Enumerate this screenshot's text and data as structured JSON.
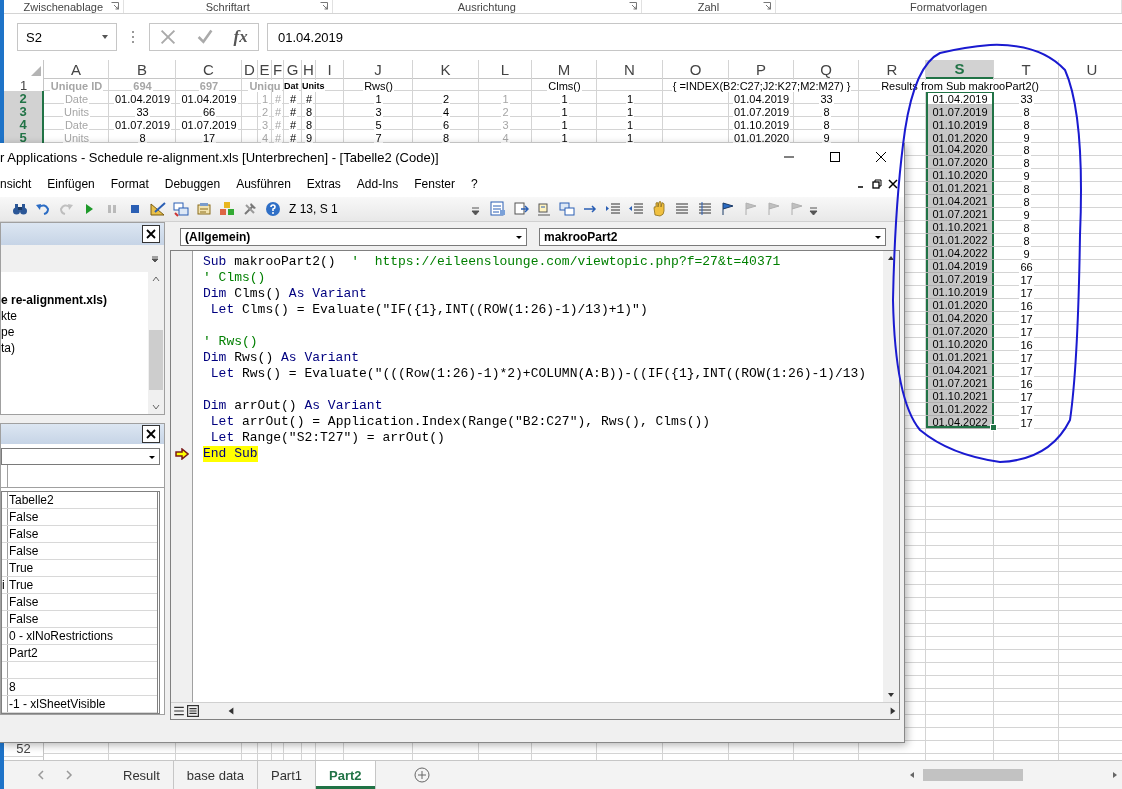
{
  "ribbon_groups": [
    {
      "label": "Zwischenablage"
    },
    {
      "label": "Schriftart"
    },
    {
      "label": "Ausrichtung"
    },
    {
      "label": "Zahl"
    },
    {
      "label": "Formatvorlagen"
    }
  ],
  "formula_bar": {
    "name_box": "S2",
    "function_label": "fx",
    "formula": "01.04.2019"
  },
  "grid": {
    "columns": [
      {
        "letter": "A",
        "selected": false
      },
      {
        "letter": "B",
        "selected": false
      },
      {
        "letter": "C",
        "selected": false
      },
      {
        "letter": "D",
        "selected": false
      },
      {
        "letter": "E",
        "selected": false
      },
      {
        "letter": "F",
        "selected": false
      },
      {
        "letter": "G",
        "selected": false
      },
      {
        "letter": "H",
        "selected": false
      },
      {
        "letter": "I",
        "selected": false
      },
      {
        "letter": "J",
        "selected": false
      },
      {
        "letter": "K",
        "selected": false
      },
      {
        "letter": "L",
        "selected": false
      },
      {
        "letter": "M",
        "selected": false
      },
      {
        "letter": "N",
        "selected": false
      },
      {
        "letter": "O",
        "selected": false
      },
      {
        "letter": "P",
        "selected": false
      },
      {
        "letter": "Q",
        "selected": false
      },
      {
        "letter": "R",
        "selected": false
      },
      {
        "letter": "S",
        "selected": true
      },
      {
        "letter": "T",
        "selected": false
      },
      {
        "letter": "U",
        "selected": false
      }
    ],
    "rows": [
      {
        "number": "1",
        "selected": false,
        "cells": {
          "A": {
            "kind": "label",
            "text": "Unique ID",
            "selected": false
          },
          "B": {
            "kind": "label",
            "text": "694",
            "selected": false
          },
          "C": {
            "kind": "label",
            "text": "697",
            "selected": false
          },
          "E": {
            "kind": "label",
            "text": "Uniqu",
            "selected": false
          },
          "G": {
            "kind": "heading",
            "text": "Dat",
            "selected": false
          },
          "H": {
            "kind": "heading",
            "text": "Units",
            "selected": false
          },
          "J": {
            "kind": "value",
            "text": "Rws()",
            "selected": false
          },
          "M": {
            "kind": "value",
            "text": "Clms()",
            "selected": false
          },
          "P": {
            "kind": "value",
            "text": "{ =INDEX(B2:C27;J2:K27;M2:M27) }",
            "selected": false
          },
          "S": {
            "kind": "value",
            "text": "Results from Sub makrooPart2()",
            "selected": false
          }
        }
      },
      {
        "number": "2",
        "selected": true,
        "cells": {
          "A": {
            "kind": "dim",
            "text": "Date",
            "selected": false
          },
          "B": {
            "kind": "value",
            "text": "01.04.2019",
            "selected": false
          },
          "C": {
            "kind": "value",
            "text": "01.04.2019",
            "selected": false
          },
          "E": {
            "kind": "dim",
            "text": "1",
            "selected": false
          },
          "F": {
            "kind": "dim",
            "text": "#",
            "selected": false
          },
          "G": {
            "kind": "value",
            "text": "#",
            "selected": false
          },
          "H": {
            "kind": "value",
            "text": "#",
            "selected": false
          },
          "J": {
            "kind": "value",
            "text": "1",
            "selected": false
          },
          "K": {
            "kind": "value",
            "text": "2",
            "selected": false
          },
          "L": {
            "kind": "dim",
            "text": "1",
            "selected": false
          },
          "M": {
            "kind": "value",
            "text": "1",
            "selected": false
          },
          "N": {
            "kind": "value",
            "text": "1",
            "selected": false
          },
          "P": {
            "kind": "value",
            "text": "01.04.2019",
            "selected": false
          },
          "Q": {
            "kind": "value",
            "text": "33",
            "selected": false
          },
          "S": {
            "kind": "value",
            "text": "01.04.2019",
            "selected": true
          },
          "T": {
            "kind": "value",
            "text": "33",
            "selected": false
          }
        }
      },
      {
        "number": "3",
        "selected": true,
        "cells": {
          "A": {
            "kind": "dim",
            "text": "Units",
            "selected": false
          },
          "B": {
            "kind": "value",
            "text": "33",
            "selected": false
          },
          "C": {
            "kind": "value",
            "text": "66",
            "selected": false
          },
          "E": {
            "kind": "dim",
            "text": "2",
            "selected": false
          },
          "F": {
            "kind": "dim",
            "text": "#",
            "selected": false
          },
          "G": {
            "kind": "value",
            "text": "#",
            "selected": false
          },
          "H": {
            "kind": "value",
            "text": "8",
            "selected": false
          },
          "J": {
            "kind": "value",
            "text": "3",
            "selected": false
          },
          "K": {
            "kind": "value",
            "text": "4",
            "selected": false
          },
          "L": {
            "kind": "dim",
            "text": "2",
            "selected": false
          },
          "M": {
            "kind": "value",
            "text": "1",
            "selected": false
          },
          "N": {
            "kind": "value",
            "text": "1",
            "selected": false
          },
          "P": {
            "kind": "value",
            "text": "01.07.2019",
            "selected": false
          },
          "Q": {
            "kind": "value",
            "text": "8",
            "selected": false
          },
          "S": {
            "kind": "value",
            "text": "01.07.2019",
            "selected": true
          },
          "T": {
            "kind": "value",
            "text": "8",
            "selected": false
          }
        }
      },
      {
        "number": "4",
        "selected": true,
        "cells": {
          "A": {
            "kind": "dim",
            "text": "Date",
            "selected": false
          },
          "B": {
            "kind": "value",
            "text": "01.07.2019",
            "selected": false
          },
          "C": {
            "kind": "value",
            "text": "01.07.2019",
            "selected": false
          },
          "E": {
            "kind": "dim",
            "text": "3",
            "selected": false
          },
          "F": {
            "kind": "dim",
            "text": "#",
            "selected": false
          },
          "G": {
            "kind": "value",
            "text": "#",
            "selected": false
          },
          "H": {
            "kind": "value",
            "text": "8",
            "selected": false
          },
          "J": {
            "kind": "value",
            "text": "5",
            "selected": false
          },
          "K": {
            "kind": "value",
            "text": "6",
            "selected": false
          },
          "L": {
            "kind": "dim",
            "text": "3",
            "selected": false
          },
          "M": {
            "kind": "value",
            "text": "1",
            "selected": false
          },
          "N": {
            "kind": "value",
            "text": "1",
            "selected": false
          },
          "P": {
            "kind": "value",
            "text": "01.10.2019",
            "selected": false
          },
          "Q": {
            "kind": "value",
            "text": "8",
            "selected": false
          },
          "S": {
            "kind": "value",
            "text": "01.10.2019",
            "selected": true
          },
          "T": {
            "kind": "value",
            "text": "8",
            "selected": false
          }
        }
      },
      {
        "number": "5",
        "selected": true,
        "cells": {
          "A": {
            "kind": "dim",
            "text": "Units",
            "selected": false
          },
          "B": {
            "kind": "value",
            "text": "8",
            "selected": false
          },
          "C": {
            "kind": "value",
            "text": "17",
            "selected": false
          },
          "E": {
            "kind": "dim",
            "text": "4",
            "selected": false
          },
          "F": {
            "kind": "dim",
            "text": "#",
            "selected": false
          },
          "G": {
            "kind": "value",
            "text": "#",
            "selected": false
          },
          "H": {
            "kind": "value",
            "text": "9",
            "selected": false
          },
          "J": {
            "kind": "value",
            "text": "7",
            "selected": false
          },
          "K": {
            "kind": "value",
            "text": "8",
            "selected": false
          },
          "L": {
            "kind": "dim",
            "text": "4",
            "selected": false
          },
          "M": {
            "kind": "value",
            "text": "1",
            "selected": false
          },
          "N": {
            "kind": "value",
            "text": "1",
            "selected": false
          },
          "P": {
            "kind": "value",
            "text": "01.01.2020",
            "selected": false
          },
          "Q": {
            "kind": "value",
            "text": "9",
            "selected": false
          },
          "S": {
            "kind": "value",
            "text": "01.01.2020",
            "selected": true
          },
          "T": {
            "kind": "value",
            "text": "9",
            "selected": false
          }
        }
      },
      {
        "cells": {
          "S": {
            "kind": "value",
            "text": "01.04.2020",
            "selected": true
          },
          "T": {
            "kind": "value",
            "text": "8",
            "selected": false
          }
        }
      },
      {
        "cells": {
          "S": {
            "kind": "value",
            "text": "01.07.2020",
            "selected": true
          },
          "T": {
            "kind": "value",
            "text": "8",
            "selected": false
          }
        }
      },
      {
        "cells": {
          "S": {
            "kind": "value",
            "text": "01.10.2020",
            "selected": true
          },
          "T": {
            "kind": "value",
            "text": "9",
            "selected": false
          }
        }
      },
      {
        "cells": {
          "S": {
            "kind": "value",
            "text": "01.01.2021",
            "selected": true
          },
          "T": {
            "kind": "value",
            "text": "8",
            "selected": false
          }
        }
      },
      {
        "cells": {
          "S": {
            "kind": "value",
            "text": "01.04.2021",
            "selected": true
          },
          "T": {
            "kind": "value",
            "text": "8",
            "selected": false
          }
        }
      },
      {
        "cells": {
          "S": {
            "kind": "value",
            "text": "01.07.2021",
            "selected": true
          },
          "T": {
            "kind": "value",
            "text": "9",
            "selected": false
          }
        }
      },
      {
        "cells": {
          "S": {
            "kind": "value",
            "text": "01.10.2021",
            "selected": true
          },
          "T": {
            "kind": "value",
            "text": "8",
            "selected": false
          }
        }
      },
      {
        "cells": {
          "S": {
            "kind": "value",
            "text": "01.01.2022",
            "selected": true
          },
          "T": {
            "kind": "value",
            "text": "8",
            "selected": false
          }
        }
      },
      {
        "cells": {
          "S": {
            "kind": "value",
            "text": "01.04.2022",
            "selected": true
          },
          "T": {
            "kind": "value",
            "text": "9",
            "selected": false
          }
        }
      },
      {
        "cells": {
          "S": {
            "kind": "value",
            "text": "01.04.2019",
            "selected": true
          },
          "T": {
            "kind": "value",
            "text": "66",
            "selected": false
          }
        }
      },
      {
        "cells": {
          "S": {
            "kind": "value",
            "text": "01.07.2019",
            "selected": true
          },
          "T": {
            "kind": "value",
            "text": "17",
            "selected": false
          }
        }
      },
      {
        "cells": {
          "S": {
            "kind": "value",
            "text": "01.10.2019",
            "selected": true
          },
          "T": {
            "kind": "value",
            "text": "17",
            "selected": false
          }
        }
      },
      {
        "cells": {
          "S": {
            "kind": "value",
            "text": "01.01.2020",
            "selected": true
          },
          "T": {
            "kind": "value",
            "text": "16",
            "selected": false
          }
        }
      },
      {
        "cells": {
          "S": {
            "kind": "value",
            "text": "01.04.2020",
            "selected": true
          },
          "T": {
            "kind": "value",
            "text": "17",
            "selected": false
          }
        }
      },
      {
        "cells": {
          "S": {
            "kind": "value",
            "text": "01.07.2020",
            "selected": true
          },
          "T": {
            "kind": "value",
            "text": "17",
            "selected": false
          }
        }
      },
      {
        "cells": {
          "S": {
            "kind": "value",
            "text": "01.10.2020",
            "selected": true
          },
          "T": {
            "kind": "value",
            "text": "16",
            "selected": false
          }
        }
      },
      {
        "cells": {
          "S": {
            "kind": "value",
            "text": "01.01.2021",
            "selected": true
          },
          "T": {
            "kind": "value",
            "text": "17",
            "selected": false
          }
        }
      },
      {
        "cells": {
          "S": {
            "kind": "value",
            "text": "01.04.2021",
            "selected": true
          },
          "T": {
            "kind": "value",
            "text": "17",
            "selected": false
          }
        }
      },
      {
        "cells": {
          "S": {
            "kind": "value",
            "text": "01.07.2021",
            "selected": true
          },
          "T": {
            "kind": "value",
            "text": "16",
            "selected": false
          }
        }
      },
      {
        "cells": {
          "S": {
            "kind": "value",
            "text": "01.10.2021",
            "selected": true
          },
          "T": {
            "kind": "value",
            "text": "17",
            "selected": false
          }
        }
      },
      {
        "cells": {
          "S": {
            "kind": "value",
            "text": "01.01.2022",
            "selected": true
          },
          "T": {
            "kind": "value",
            "text": "17",
            "selected": false
          }
        }
      },
      {
        "cells": {
          "S": {
            "kind": "value",
            "text": "01.04.2022",
            "selected": true
          },
          "T": {
            "kind": "value",
            "text": "17",
            "selected": false
          }
        }
      }
    ],
    "tail_rows": [
      {
        "number": "52",
        "selected": false
      }
    ]
  },
  "sheet_tabs": [
    {
      "label": "Result",
      "selected": false
    },
    {
      "label": "base data",
      "selected": false
    },
    {
      "label": "Part1",
      "selected": false
    },
    {
      "label": "Part2",
      "selected": true
    }
  ],
  "vba": {
    "title": "r Applications - Schedule re-alignment.xls [Unterbrechen] - [Tabelle2 (Code)]",
    "menu": [
      {
        "label": "nsicht"
      },
      {
        "label": "Einfügen"
      },
      {
        "label": "Format"
      },
      {
        "label": "Debuggen"
      },
      {
        "label": "Ausführen"
      },
      {
        "label": "Extras"
      },
      {
        "label": "Add-Ins"
      },
      {
        "label": "Fenster"
      },
      {
        "label": "?"
      }
    ],
    "toolbar": {
      "left": [
        {
          "disabled": false
        },
        {
          "disabled": false
        },
        {
          "disabled": true
        },
        {
          "disabled": false
        },
        {
          "disabled": true
        },
        {
          "disabled": false
        },
        {
          "disabled": false
        },
        {
          "disabled": false
        },
        {
          "disabled": false
        },
        {
          "disabled": false
        },
        {
          "disabled": false
        },
        {
          "disabled": false
        }
      ],
      "position": "Z 13, S 1",
      "right": [
        {
          "disabled": false
        },
        {
          "disabled": false
        },
        {
          "disabled": false
        },
        {
          "disabled": false
        },
        {
          "disabled": false
        },
        {
          "disabled": false
        },
        {
          "disabled": false
        },
        {
          "disabled": false
        },
        {
          "disabled": false
        },
        {
          "disabled": false
        },
        {
          "disabled": false
        },
        {
          "disabled": true
        },
        {
          "disabled": true
        },
        {
          "disabled": true
        }
      ]
    },
    "project": {
      "label": "e re-alignment.xls)",
      "children": [
        {
          "label": "kte"
        },
        {
          "label": "pe",
          "children": [
            {
              "label": "ta)"
            }
          ]
        }
      ]
    },
    "properties": [
      {
        "kind": "value",
        "value": "Tabelle2"
      },
      {
        "kind": "value",
        "value": "False"
      },
      {
        "kind": "value",
        "value": "False"
      },
      {
        "kind": "value",
        "value": "False"
      },
      {
        "kind": "value",
        "value": "True"
      },
      {
        "kind": "value",
        "name": "i",
        "value": "True"
      },
      {
        "kind": "value",
        "value": "False"
      },
      {
        "kind": "value",
        "value": "False"
      },
      {
        "kind": "value",
        "value": "0 - xlNoRestrictions"
      },
      {
        "kind": "value",
        "value": "Part2"
      },
      {
        "kind": "blank"
      },
      {
        "kind": "value",
        "value": "8"
      },
      {
        "kind": "value",
        "value": "-1 - xlSheetVisible"
      }
    ],
    "code": {
      "object": "(Allgemein)",
      "procedure": "makrooPart2",
      "lines": [
        {
          "kind": "code",
          "current": false,
          "tokens": [
            {
              "kind": "keyword",
              "text": "Sub"
            },
            {
              "kind": "plain",
              "text": " makrooPart2()  "
            },
            {
              "kind": "comment",
              "text": "'  https://eileenslounge.com/viewtopic.php?f=27&t=40371"
            }
          ]
        },
        {
          "kind": "code",
          "current": false,
          "tokens": [
            {
              "kind": "comment",
              "text": "' Clms()"
            }
          ]
        },
        {
          "kind": "code",
          "current": false,
          "tokens": [
            {
              "kind": "keyword",
              "text": "Dim"
            },
            {
              "kind": "plain",
              "text": " Clms() "
            },
            {
              "kind": "keyword",
              "text": "As Variant"
            }
          ]
        },
        {
          "kind": "code",
          "current": false,
          "tokens": [
            {
              "kind": "keyword",
              "text": " Let"
            },
            {
              "kind": "plain",
              "text": " Clms() = Evaluate(\"IF({1},INT((ROW(1:26)-1)/13)+1)\")"
            }
          ]
        },
        {
          "kind": "blank",
          "current": false
        },
        {
          "kind": "code",
          "current": false,
          "tokens": [
            {
              "kind": "comment",
              "text": "' Rws()"
            }
          ]
        },
        {
          "kind": "code",
          "current": false,
          "tokens": [
            {
              "kind": "keyword",
              "text": "Dim"
            },
            {
              "kind": "plain",
              "text": " Rws() "
            },
            {
              "kind": "keyword",
              "text": "As Variant"
            }
          ]
        },
        {
          "kind": "code",
          "current": false,
          "tokens": [
            {
              "kind": "keyword",
              "text": " Let"
            },
            {
              "kind": "plain",
              "text": " Rws() = Evaluate(\"(((Row(1:26)-1)*2)+COLUMN(A:B))-((IF({1},INT((ROW(1:26)-1)/13)"
            }
          ]
        },
        {
          "kind": "blank",
          "current": false
        },
        {
          "kind": "code",
          "current": false,
          "tokens": [
            {
              "kind": "keyword",
              "text": "Dim"
            },
            {
              "kind": "plain",
              "text": " arrOut() "
            },
            {
              "kind": "keyword",
              "text": "As Variant"
            }
          ]
        },
        {
          "kind": "code",
          "current": false,
          "tokens": [
            {
              "kind": "keyword",
              "text": " Let"
            },
            {
              "kind": "plain",
              "text": " arrOut() = Application.Index(Range(\"B2:C27\"), Rws(), Clms())"
            }
          ]
        },
        {
          "kind": "code",
          "current": false,
          "tokens": [
            {
              "kind": "keyword",
              "text": " Let"
            },
            {
              "kind": "plain",
              "text": " Range(\"S2:T27\") = arrOut()"
            }
          ]
        },
        {
          "kind": "code",
          "current": true,
          "tokens": [
            {
              "kind": "keyword",
              "text": "End Sub"
            }
          ]
        }
      ]
    }
  }
}
